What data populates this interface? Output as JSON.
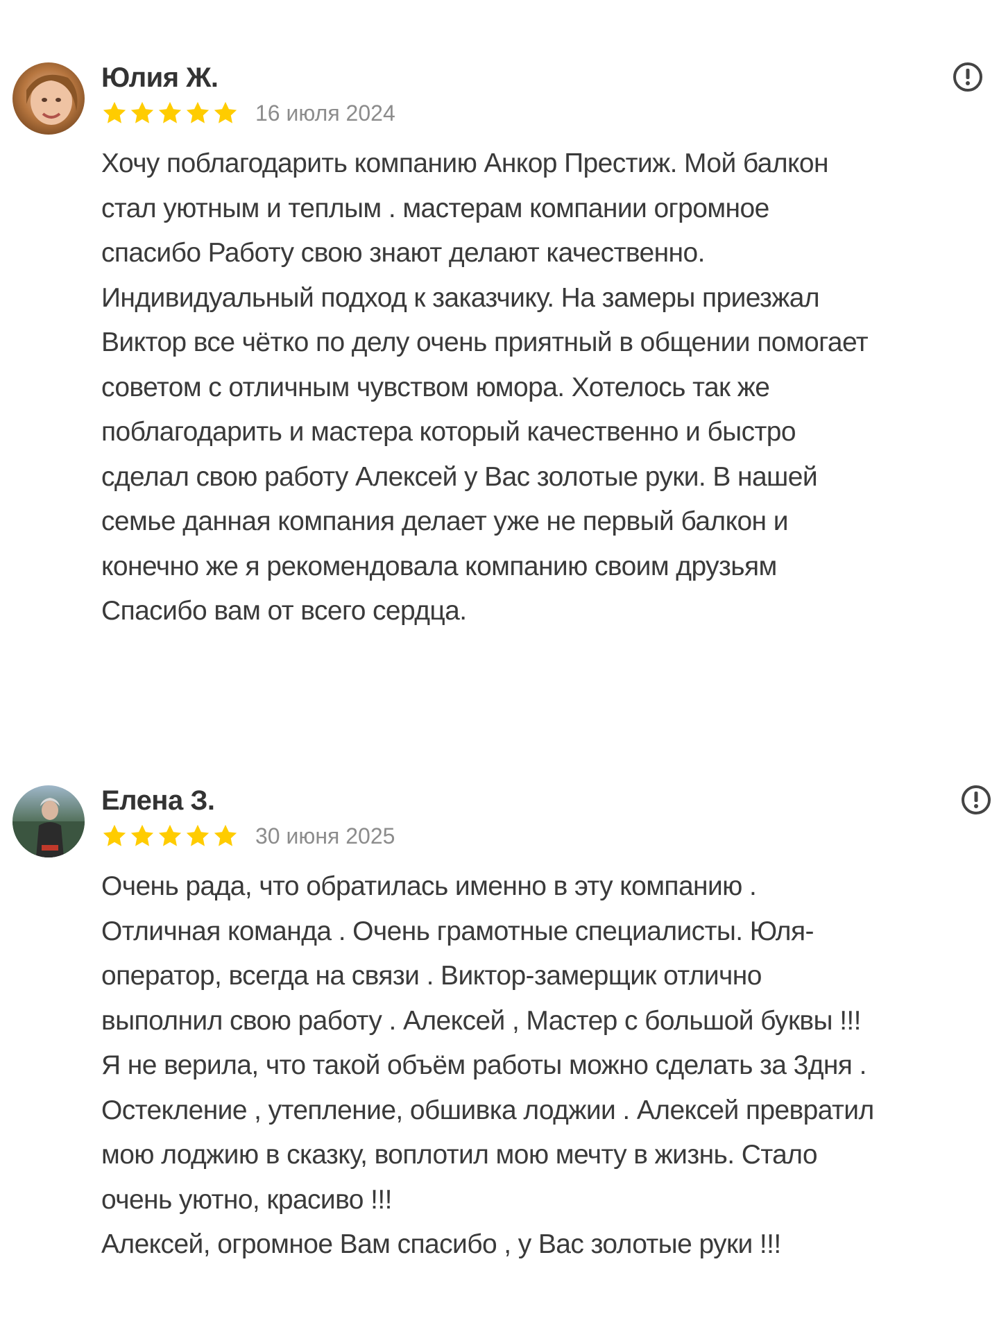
{
  "reviews": [
    {
      "author": "Юлия Ж.",
      "rating": 5,
      "date": "16 июля 2024",
      "avatar_icon": "user-photo-avatar",
      "report_icon": "exclamation-circle-icon",
      "text_lines": [
        "Хочу поблагодарить компанию Анкор Престиж. Мой балкон",
        "стал уютным и теплым . мастерам компании огромное",
        "спасибо Работу свою знают делают качественно.",
        "Индивидуальный подход к заказчику. На замеры приезжал",
        "Виктор все чётко по делу очень приятный в общении помогает",
        "советом с отличным чувством юмора. Хотелось так же",
        "поблагодарить и мастера который качественно и быстро",
        "сделал свою работу Алексей у Вас золотые руки. В нашей",
        "семье данная компания делает уже не первый балкон и",
        "конечно же я рекомендовала компанию своим друзьям",
        "Спасибо вам от всего сердца."
      ]
    },
    {
      "author": "Елена З.",
      "rating": 5,
      "date": "30 июня 2025",
      "avatar_icon": "user-photo-avatar",
      "report_icon": "exclamation-circle-icon",
      "text_lines": [
        "Очень рада, что обратилась именно в эту компанию .",
        "Отличная команда . Очень грамотные специалисты. Юля-",
        "оператор, всегда на связи . Виктор-замерщик отлично",
        "выполнил свою работу . Алексей , Мастер с большой буквы !!!",
        "Я не верила, что такой объём работы можно сделать за 3дня .",
        "Остекление , утепление, обшивка лоджии . Алексей превратил",
        "мою лоджию в сказку, воплотил мою мечту в жизнь. Стало",
        "очень уютно, красиво !!!",
        "Алексей, огромное Вам спасибо , у Вас золотые руки !!!"
      ]
    }
  ],
  "colors": {
    "star": "#FFCC00",
    "author": "#333333",
    "date": "#8C8C8C",
    "body_text": "#3A3A3A",
    "report_icon": "#444444"
  }
}
